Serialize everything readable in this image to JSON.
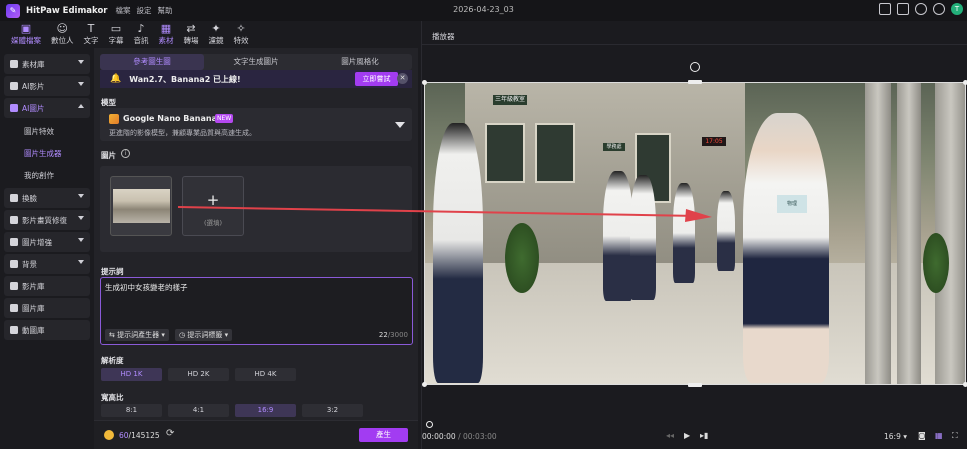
{
  "app": {
    "name": "HitPaw Edimakor",
    "menu": [
      "檔案",
      "設定",
      "幫助"
    ],
    "project_title": "2026-04-23_03",
    "avatar_letter": "T"
  },
  "toolbar": {
    "items": [
      {
        "label": "媒體檔案",
        "icon": "media-icon",
        "glyph": "▣",
        "active": true
      },
      {
        "label": "數位人",
        "icon": "avatar-icon",
        "glyph": "☺"
      },
      {
        "label": "文字",
        "icon": "text-icon",
        "glyph": "T"
      },
      {
        "label": "字幕",
        "icon": "subtitle-icon",
        "glyph": "▭"
      },
      {
        "label": "音訊",
        "icon": "audio-icon",
        "glyph": "♪"
      },
      {
        "label": "素材",
        "icon": "assets-icon",
        "glyph": "▦",
        "active": true
      },
      {
        "label": "轉場",
        "icon": "transition-icon",
        "glyph": "⇄"
      },
      {
        "label": "濾鏡",
        "icon": "filter-icon",
        "glyph": "✦"
      },
      {
        "label": "特效",
        "icon": "effects-icon",
        "glyph": "✧"
      }
    ]
  },
  "sidebar": {
    "items": [
      {
        "label": "素材庫",
        "caret": true
      },
      {
        "label": "AI影片",
        "caret": true
      },
      {
        "label": "AI圖片",
        "caret": true,
        "open": true,
        "highlight": true
      },
      {
        "label": "換臉",
        "caret": true
      },
      {
        "label": "影片畫質修復",
        "caret": true
      },
      {
        "label": "圖片增強",
        "caret": true
      },
      {
        "label": "背景",
        "caret": true
      },
      {
        "label": "影片庫"
      },
      {
        "label": "圖片庫"
      },
      {
        "label": "動圖庫"
      }
    ],
    "sub_items": [
      {
        "label": "圖片特效"
      },
      {
        "label": "圖片生成器",
        "active": true
      },
      {
        "label": "我的創作"
      }
    ]
  },
  "panel": {
    "tabs": [
      {
        "label": "參考圖生圖",
        "active": true
      },
      {
        "label": "文字生成圖片"
      },
      {
        "label": "圖片風格化"
      }
    ],
    "banner": {
      "text": "Wan2.7、Banana2 已上線!",
      "button": "立即嘗試",
      "close": "✕"
    },
    "model": {
      "section_label": "模型",
      "name": "Google Nano Banana2",
      "badge": "NEW",
      "description": "更進階的影像模型，兼顧專業品質與高速生成。"
    },
    "images": {
      "section_label": "圖片",
      "info": "i",
      "add_plus": "+",
      "add_label": "(選填)"
    },
    "prompt": {
      "section_label": "提示詞",
      "text": "生成初中女孩變老的樣子",
      "btn_generator": "提示詞產生器",
      "btn_tags": "提示詞標籤",
      "count": "22",
      "max": "/3000"
    },
    "resolution": {
      "section_label": "解析度",
      "options": [
        {
          "label": "HD 1K",
          "active": true
        },
        {
          "label": "HD 2K"
        },
        {
          "label": "HD 4K"
        }
      ]
    },
    "aspect": {
      "section_label": "寬高比",
      "options": [
        {
          "label": "8:1"
        },
        {
          "label": "4:1"
        },
        {
          "label": "16:9",
          "active": true
        },
        {
          "label": "3:2"
        }
      ]
    },
    "footer": {
      "credits_used": "60",
      "credits_total": "/145125",
      "generate": "產生"
    }
  },
  "player": {
    "title": "播放器",
    "time_current": "00:00:00",
    "time_total": " / 00:03:00",
    "ratio": "16:9",
    "scene_text": {
      "sign_left": "三年級教室",
      "sign_mid": "學務處",
      "clock": "17:05",
      "book": "物理"
    }
  },
  "colors": {
    "accent": "#a23cf2",
    "accent_text": "#b18cff",
    "background": "#1b1b1f",
    "panel": "#232328",
    "arrow": "#e0424a"
  }
}
